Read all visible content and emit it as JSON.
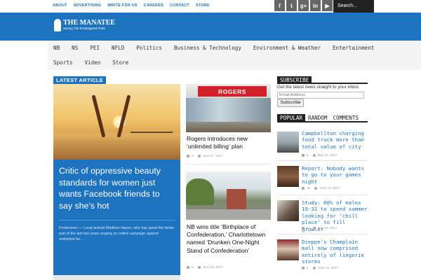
{
  "toplinks": [
    "ABOUT",
    "ADVERTISING",
    "WRITE FOR US",
    "CAREERS",
    "CONTACT",
    "STORE"
  ],
  "social": [
    {
      "icon": "facebook-icon",
      "glyph": "f"
    },
    {
      "icon": "twitter-icon",
      "glyph": "t"
    },
    {
      "icon": "google-plus-icon",
      "glyph": "g+"
    },
    {
      "icon": "linkedin-icon",
      "glyph": "in"
    },
    {
      "icon": "youtube-icon",
      "glyph": "▶"
    }
  ],
  "search": {
    "placeholder": "Search..."
  },
  "logo": {
    "title": "THE MANATEE",
    "tagline": "Saving The Endangered Truth"
  },
  "nav": {
    "row1": [
      "NB",
      "NS",
      "PEI",
      "NFLD",
      "Politics",
      "Business & Technology",
      "Environment & Weather",
      "Entertainment"
    ],
    "row2": [
      "Sports",
      "Video",
      "Store"
    ]
  },
  "latest": {
    "label": "LATEST ARTICLE",
    "title": "Critic of oppressive beauty standards for women just wants Facebook friends to say she’s hot",
    "excerpt": "Fredericton — Local activist Madison Hayes, who has spent the better part of the last two years waging an online campaign against restrictive be..."
  },
  "articles": [
    {
      "title": "Rogers introduces new ‘unlimited billing’ plan",
      "comments": "5",
      "date": "June 27, 2017",
      "sign": "ROGERS"
    },
    {
      "title": "NB wins title ‘Birthplace of Confederation,’ Charlottetown named ‘Drunken One-Night Stand of Confederation’",
      "comments": "6",
      "date": "June 26, 2017"
    }
  ],
  "subscribe": {
    "label": "SUBSCRIBE",
    "text": "Get the latest news straight to your inbox.",
    "email_placeholder": "Email Address",
    "button": "Subscribe"
  },
  "tabs": [
    "POPULAR",
    "RANDOM",
    "COMMENTS"
  ],
  "popular": [
    {
      "title": "Campbellton charging food truck more than total value of city",
      "comments": "5",
      "date": "May 20, 2017"
    },
    {
      "title": "Report: Nobody wants to go to your games night",
      "comments": "15",
      "date": "June 14, 2017"
    },
    {
      "title": "Study: 60% of males 19-31 to spend summer looking for ‘chill place’ to fill growler",
      "comments": "5",
      "date": "May 26, 2017"
    },
    {
      "title": "Dieppe’s Champlain mall now comprised entirely of lingerie stores",
      "comments": "5",
      "date": "June 12, 2017"
    }
  ]
}
